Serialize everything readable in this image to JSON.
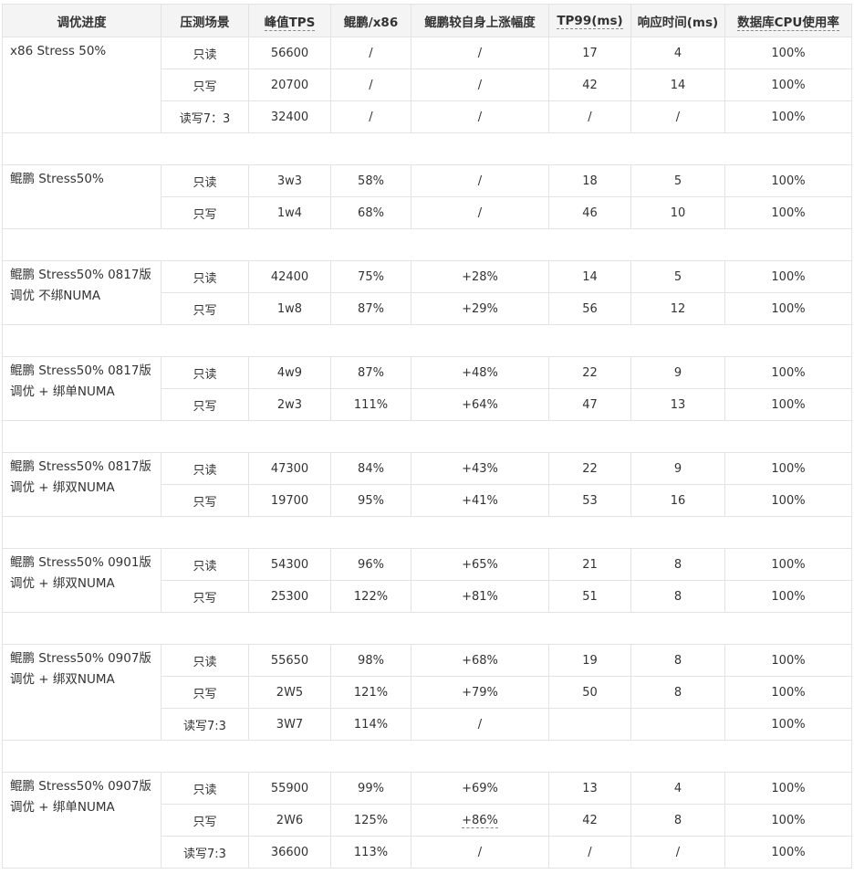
{
  "headers": [
    "调优进度",
    "压测场景",
    "峰值TPS",
    "鲲鹏/x86",
    "鲲鹏较自身上涨幅度",
    "TP99(ms)",
    "响应时间(ms)",
    "数据库CPU使用率"
  ],
  "groups": [
    {
      "stage": "x86 Stress 50%",
      "rows": [
        {
          "scenario": "只读",
          "tps": "56600",
          "ratio": "/",
          "increase": "/",
          "tp99": "17",
          "resp": "4",
          "cpu": "100%"
        },
        {
          "scenario": "只写",
          "tps": "20700",
          "ratio": "/",
          "increase": "/",
          "tp99": "42",
          "resp": "14",
          "cpu": "100%"
        },
        {
          "scenario": "读写7：3",
          "tps": "32400",
          "ratio": "/",
          "increase": "/",
          "tp99": "/",
          "resp": "/",
          "cpu": "100%"
        }
      ]
    },
    {
      "stage": "鲲鹏 Stress50%",
      "rows": [
        {
          "scenario": "只读",
          "tps": "3w3",
          "ratio": "58%",
          "increase": "/",
          "tp99": "18",
          "resp": "5",
          "cpu": "100%"
        },
        {
          "scenario": "只写",
          "tps": "1w4",
          "ratio": "68%",
          "increase": "/",
          "tp99": "46",
          "resp": "10",
          "cpu": "100%"
        }
      ]
    },
    {
      "stage": "鲲鹏 Stress50% 0817版调优 不绑NUMA",
      "rows": [
        {
          "scenario": "只读",
          "tps": "42400",
          "ratio": "75%",
          "increase": "+28%",
          "tp99": "14",
          "resp": "5",
          "cpu": "100%"
        },
        {
          "scenario": "只写",
          "tps": "1w8",
          "ratio": "87%",
          "increase": "+29%",
          "tp99": "56",
          "resp": "12",
          "cpu": "100%"
        }
      ]
    },
    {
      "stage": "鲲鹏 Stress50% 0817版调优 + 绑单NUMA",
      "rows": [
        {
          "scenario": "只读",
          "tps": "4w9",
          "ratio": "87%",
          "increase": "+48%",
          "tp99": "22",
          "resp": "9",
          "cpu": "100%"
        },
        {
          "scenario": "只写",
          "tps": "2w3",
          "ratio": "111%",
          "increase": "+64%",
          "tp99": "47",
          "resp": "13",
          "cpu": "100%"
        }
      ]
    },
    {
      "stage": "鲲鹏 Stress50% 0817版调优 + 绑双NUMA",
      "rows": [
        {
          "scenario": "只读",
          "tps": "47300",
          "ratio": "84%",
          "increase": "+43%",
          "tp99": "22",
          "resp": "9",
          "cpu": "100%"
        },
        {
          "scenario": "只写",
          "tps": "19700",
          "ratio": "95%",
          "increase": "+41%",
          "tp99": "53",
          "resp": "16",
          "cpu": "100%"
        }
      ]
    },
    {
      "stage": "鲲鹏 Stress50% 0901版调优 + 绑双NUMA",
      "rows": [
        {
          "scenario": "只读",
          "tps": "54300",
          "ratio": "96%",
          "increase": "+65%",
          "tp99": "21",
          "resp": "8",
          "cpu": "100%"
        },
        {
          "scenario": "只写",
          "tps": "25300",
          "ratio": "122%",
          "increase": "+81%",
          "tp99": "51",
          "resp": "8",
          "cpu": "100%"
        }
      ]
    },
    {
      "stage": "鲲鹏 Stress50% 0907版调优 + 绑双NUMA",
      "rows": [
        {
          "scenario": "只读",
          "tps": "55650",
          "ratio": "98%",
          "increase": "+68%",
          "tp99": "19",
          "resp": "8",
          "cpu": "100%"
        },
        {
          "scenario": "只写",
          "tps": "2W5",
          "ratio": "121%",
          "increase": "+79%",
          "tp99": "50",
          "resp": "8",
          "cpu": "100%"
        },
        {
          "scenario": "读写7:3",
          "tps": "3W7",
          "ratio": "114%",
          "increase": "/",
          "tp99": "",
          "resp": "",
          "cpu": "100%"
        }
      ]
    },
    {
      "stage": "鲲鹏 Stress50% 0907版调优 + 绑单NUMA",
      "rows": [
        {
          "scenario": "只读",
          "tps": "55900",
          "ratio": "99%",
          "increase": "+69%",
          "tp99": "13",
          "resp": "4",
          "cpu": "100%"
        },
        {
          "scenario": "只写",
          "tps": "2W6",
          "ratio": "125%",
          "increase": "+86%",
          "tp99": "42",
          "resp": "8",
          "cpu": "100%"
        },
        {
          "scenario": "读写7:3",
          "tps": "36600",
          "ratio": "113%",
          "increase": "/",
          "tp99": "/",
          "resp": "/",
          "cpu": "100%"
        }
      ]
    }
  ],
  "colors": {
    "increase_positive": "#3e9e2e",
    "scenario_link": "#3f7fdd",
    "header_bg": "#f4f4f4",
    "border": "#e3e3e3"
  }
}
